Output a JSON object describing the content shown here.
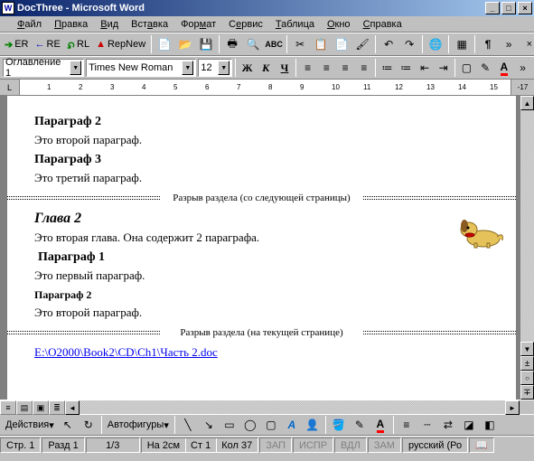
{
  "title": "DocThree - Microsoft Word",
  "menu": [
    "Файл",
    "Правка",
    "Вид",
    "Вставка",
    "Формат",
    "Сервис",
    "Таблица",
    "Окно",
    "Справка"
  ],
  "nav": {
    "er": "ER",
    "re": "RE",
    "rl": "RL",
    "repnew": "RepNew"
  },
  "style_combo": "Оглавление 1",
  "font_combo": "Times New Roman",
  "size_combo": "12",
  "ruler_end": "-17",
  "doc": {
    "h_p2": "Параграф 2",
    "t_p2": "Это второй параграф.",
    "h_p3": "Параграф 3",
    "t_p3": "Это третий параграф.",
    "break1": "Разрыв раздела (со следующей страницы)",
    "h_ch2": "Глава 2",
    "t_ch2": "Это вторая глава. Она содержит 2 параграфа.",
    "h_pp1": "Параграф 1",
    "t_pp1": "Это первый параграф.",
    "h_pp2": "Параграф 2",
    "t_pp2": "Это второй параграф.",
    "break2": "Разрыв раздела (на текущей странице)",
    "link": "E:\\O2000\\Book2\\CD\\Ch1\\Часть 2.doc"
  },
  "draw": {
    "actions": "Действия",
    "autoshapes": "Автофигуры"
  },
  "status": {
    "page": "Стр. 1",
    "sect": "Разд 1",
    "pages": "1/3",
    "at": "На 2см",
    "line": "Ст 1",
    "col": "Кол 37",
    "zap": "ЗАП",
    "ispr": "ИСПР",
    "vdl": "ВДЛ",
    "zam": "ЗАМ",
    "lang": "русский (Ро"
  }
}
